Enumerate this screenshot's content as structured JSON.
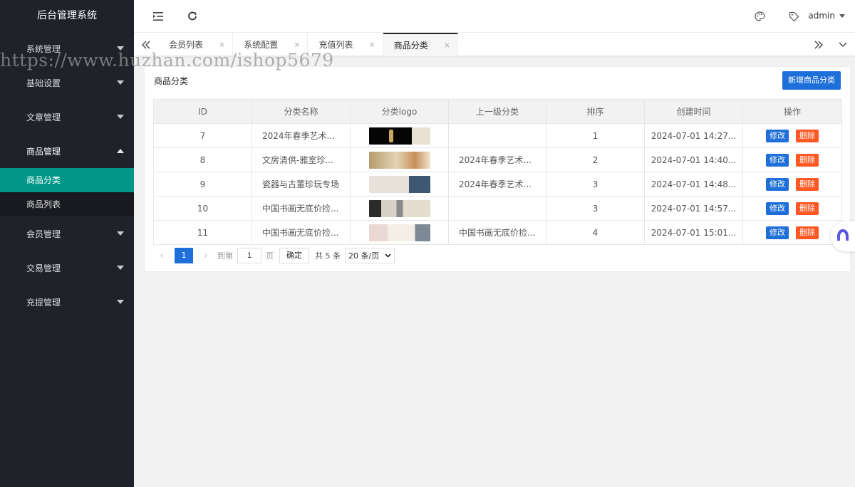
{
  "sidebar": {
    "brand": "后台管理系统",
    "groups": [
      {
        "label": "系统管理"
      },
      {
        "label": "基础设置"
      },
      {
        "label": "文章管理"
      },
      {
        "label": "商品管理",
        "children": [
          "商品分类",
          "商品列表"
        ]
      },
      {
        "label": "会员管理"
      },
      {
        "label": "交易管理"
      },
      {
        "label": "充提管理"
      }
    ]
  },
  "header": {
    "user": "admin",
    "icons": [
      "menu-fold-icon",
      "refresh-icon",
      "theme-palette-icon",
      "tag-icon",
      "chevron-down-icon"
    ]
  },
  "tabs": {
    "items": [
      {
        "label": "会员列表"
      },
      {
        "label": "系统配置"
      },
      {
        "label": "充值列表"
      },
      {
        "label": "商品分类",
        "active": true
      }
    ],
    "close_glyph": "×"
  },
  "card": {
    "title": "商品分类",
    "add_button": "新增商品分类"
  },
  "table": {
    "columns": [
      "ID",
      "分类名称",
      "分类logo",
      "上一级分类",
      "排序",
      "创建时间",
      "操作"
    ],
    "rows": [
      {
        "id": "7",
        "name": "2024年春季艺术...",
        "parent": "",
        "sort": "1",
        "created": "2024-07-01 14:27...",
        "edit": "修改",
        "del": "删除"
      },
      {
        "id": "8",
        "name": "文房清供-雅室珍...",
        "parent": "2024年春季艺术...",
        "sort": "2",
        "created": "2024-07-01 14:40...",
        "edit": "修改",
        "del": "删除"
      },
      {
        "id": "9",
        "name": "瓷器与古董珍玩专场",
        "parent": "2024年春季艺术...",
        "sort": "3",
        "created": "2024-07-01 14:48...",
        "edit": "修改",
        "del": "删除"
      },
      {
        "id": "10",
        "name": "中国书画无底价捡...",
        "parent": "",
        "sort": "3",
        "created": "2024-07-01 14:57...",
        "edit": "修改",
        "del": "删除"
      },
      {
        "id": "11",
        "name": "中国书画无底价捡...",
        "parent": "中国书画无底价捡...",
        "sort": "4",
        "created": "2024-07-01 15:01...",
        "edit": "修改",
        "del": "删除"
      }
    ]
  },
  "pager": {
    "prev": "‹",
    "current": "1",
    "next": "›",
    "goto_label": "到第",
    "goto_value": "1",
    "page_unit": "页",
    "confirm": "确定",
    "total": "共 5 条",
    "page_size": "20 条/页"
  },
  "watermark": "https://www.huzhan.com/ishop5679",
  "colors": {
    "sidebar_bg": "#20222a",
    "active_green": "#009688",
    "primary_blue": "#1e6fd9",
    "danger_orange": "#ff5722"
  }
}
